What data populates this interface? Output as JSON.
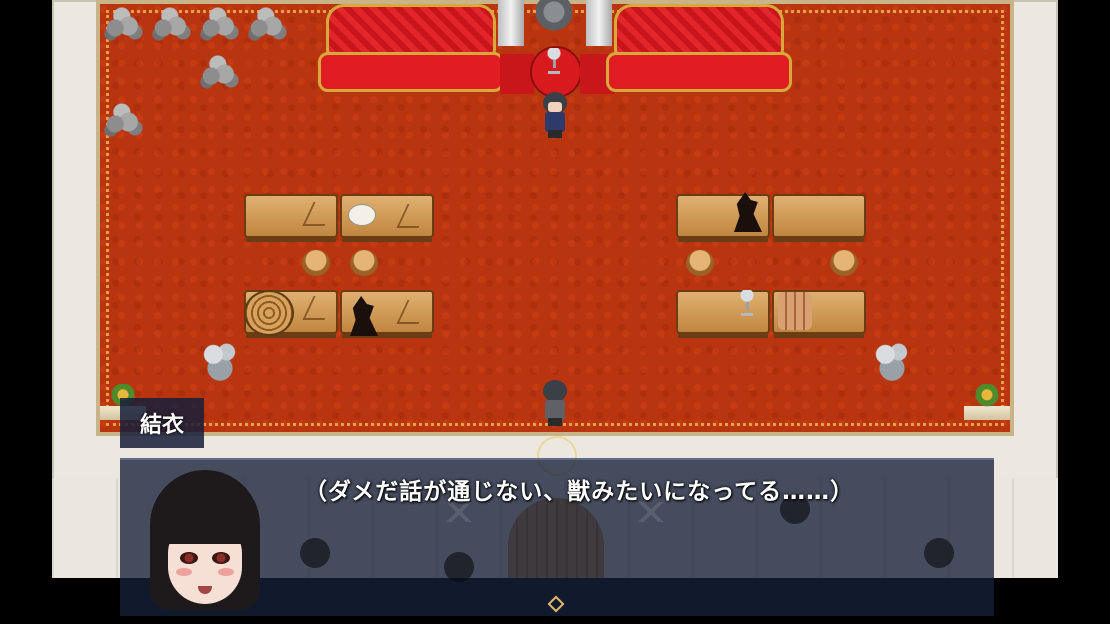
{
  "message_window": {
    "speaker_name": "結衣",
    "text": "（ダメだ話が通じない、獣みたいになってる……）"
  },
  "portrait": {
    "icon": "yui-portrait-icon"
  },
  "colors": {
    "carpet": "#b8350f",
    "window_bg": "#16203a",
    "sofa_red": "#e11c22",
    "text": "#ffffff"
  }
}
